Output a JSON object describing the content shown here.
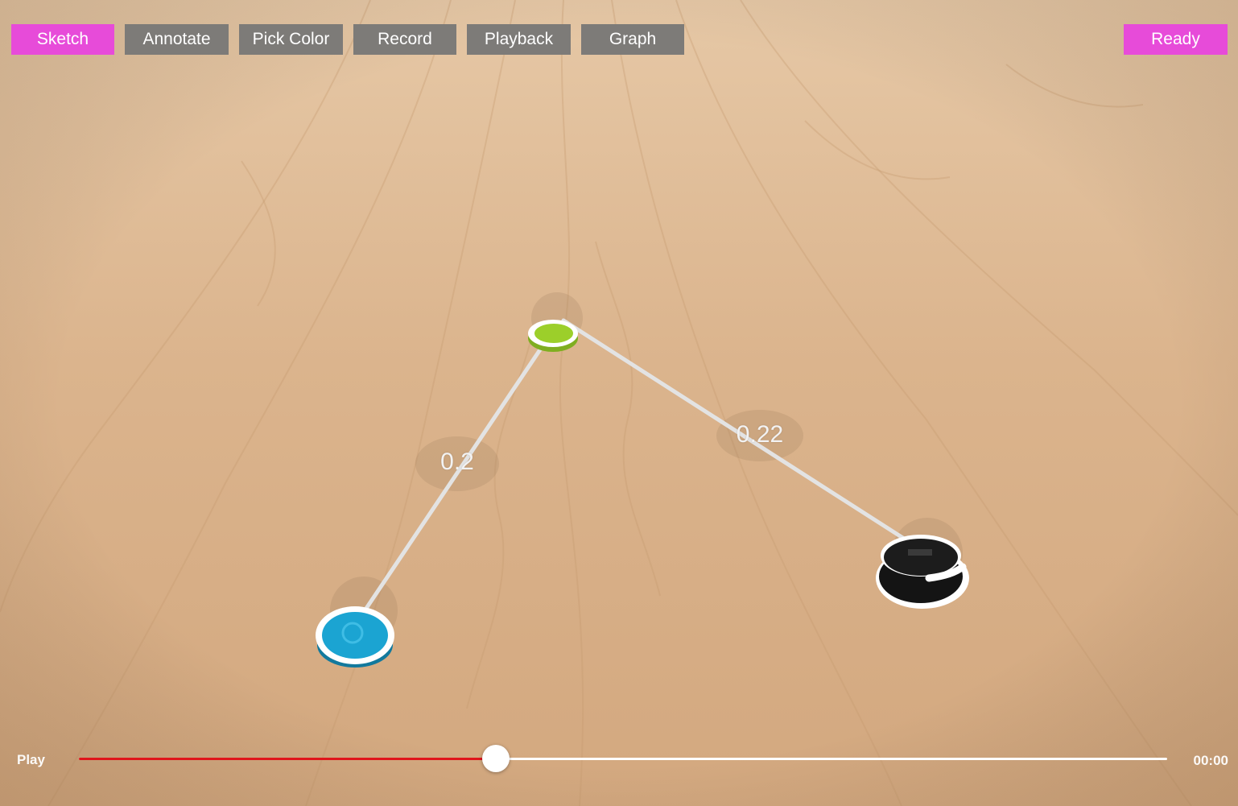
{
  "toolbar": {
    "sketch": "Sketch",
    "annotate": "Annotate",
    "pick_color": "Pick Color",
    "record": "Record",
    "playback": "Playback",
    "graph": "Graph",
    "ready": "Ready"
  },
  "scene": {
    "measurements": [
      {
        "value": "0.2"
      },
      {
        "value": "0.22"
      }
    ],
    "pucks": [
      {
        "name": "green",
        "color": "#9ccf2a"
      },
      {
        "name": "blue",
        "color": "#1ba4d2"
      },
      {
        "name": "black",
        "color": "#141414"
      }
    ]
  },
  "playback_bar": {
    "play_label": "Play",
    "time": "00:00",
    "progress": 0.383
  },
  "colors": {
    "accent_pink": "#e74bd9",
    "button_gray": "#7d7b78",
    "slider_red": "#e0151b"
  }
}
